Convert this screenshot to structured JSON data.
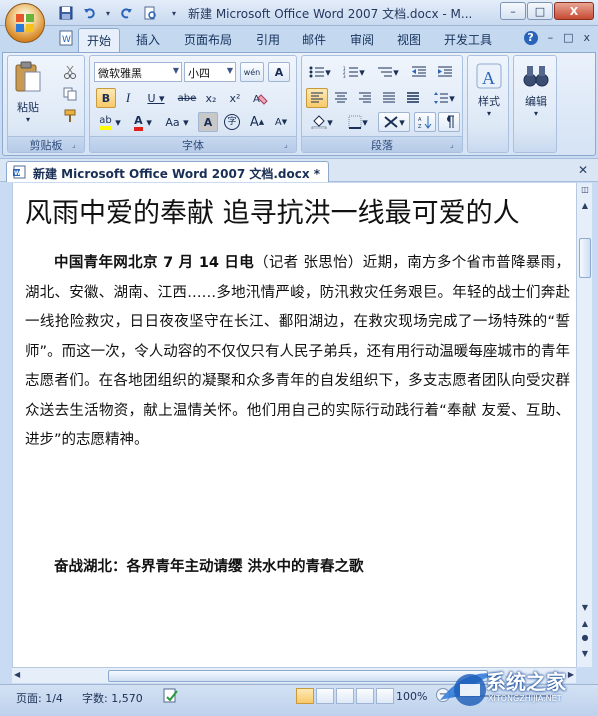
{
  "window": {
    "title": "新建 Microsoft Office Word 2007 文档.docx - M...",
    "controls": {
      "minimize": "–",
      "maximize": "□",
      "close": "X"
    }
  },
  "ribbon_tabs": [
    {
      "label": "开始",
      "active": true
    },
    {
      "label": "插入"
    },
    {
      "label": "页面布局"
    },
    {
      "label": "引用"
    },
    {
      "label": "邮件"
    },
    {
      "label": "审阅"
    },
    {
      "label": "视图"
    },
    {
      "label": "开发工具"
    }
  ],
  "ribbon_right": {
    "help": "?",
    "minimize": "–",
    "restore": "□",
    "close": "x"
  },
  "groups": {
    "clipboard": {
      "label": "剪贴板",
      "paste": "粘贴"
    },
    "font": {
      "label": "字体",
      "font_name": "微软雅黑",
      "font_size": "小四",
      "wen": "wén",
      "grow": "A",
      "bold": "B",
      "italic": "I",
      "underline": "U",
      "strike": "abe",
      "subscript": "x₂",
      "superscript": "x²",
      "highlight": "ab",
      "color": "A",
      "case": "Aa",
      "char_border": "A",
      "enclose": "字",
      "size_up": "A",
      "size_down": "A"
    },
    "paragraph": {
      "label": "段落"
    },
    "styles": {
      "label": "样式"
    },
    "editing": {
      "label": "编辑"
    }
  },
  "document": {
    "tab_label": "新建 Microsoft Office Word 2007 文档.docx *",
    "title": "风雨中爱的奉献 追寻抗洪一线最可爱的人",
    "lead_bold": "中国青年网北京 7 月 14 日电",
    "body": "（记者 张思怡）近期，南方多个省市普降暴雨，湖北、安徽、湖南、江西……多地汛情严峻，防汛救灾任务艰巨。年轻的战士们奔赴一线抢险救灾，日日夜夜坚守在长江、鄱阳湖边，在救灾现场完成了一场特殊的“誓师”。而这一次，令人动容的不仅仅只有人民子弟兵，还有用行动温暖每座城市的青年志愿者们。在各地团组织的凝聚和众多青年的自发组织下，多支志愿者团队向受灾群众送去生活物资，献上温情关怀。他们用自己的实际行动践行着“奉献 友爱、互助、进步”的志愿精神。",
    "subheading": "奋战湖北：各界青年主动请缨 洪水中的青春之歌"
  },
  "status": {
    "page": "页面: 1/4",
    "words": "字数: 1,570",
    "zoom": "100%"
  },
  "watermark": {
    "text": "系统之家",
    "url": "XITONGZHIJIA.NET"
  }
}
